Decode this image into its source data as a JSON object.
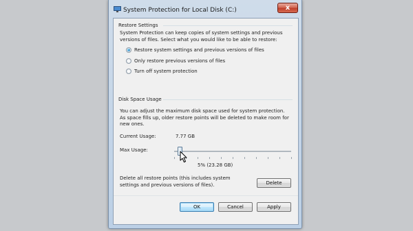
{
  "window": {
    "title": "System Protection for Local Disk (C:)",
    "close_glyph": "x"
  },
  "restore_settings": {
    "heading": "Restore Settings",
    "description": "System Protection can keep copies of system settings and previous versions of files. Select what you would like to be able to restore:",
    "options": [
      {
        "label": "Restore system settings and previous versions of files",
        "selected": true
      },
      {
        "label": "Only restore previous versions of files",
        "selected": false
      },
      {
        "label": "Turn off system protection",
        "selected": false
      }
    ]
  },
  "disk_space": {
    "heading": "Disk Space Usage",
    "description": "You can adjust the maximum disk space used for system protection. As space fills up, older restore points will be deleted to make room for new ones.",
    "current_usage_label": "Current Usage:",
    "current_usage_value": "7.77 GB",
    "max_usage_label": "Max Usage:",
    "max_usage_readout": "5% (23.28 GB)",
    "max_usage_fraction": 0.05
  },
  "delete": {
    "description": "Delete all restore points (this includes system settings and previous versions of files).",
    "button_label": "Delete"
  },
  "footer": {
    "ok_label": "OK",
    "cancel_label": "Cancel",
    "apply_label": "Apply"
  },
  "colors": {
    "background": "#c7c9cc",
    "client": "#f0f0f0",
    "close_button": "#c0402b",
    "default_button_border": "#3c7fb1"
  },
  "icons": [
    "shield-computer-icon",
    "close-icon",
    "mouse-pointer-icon"
  ]
}
